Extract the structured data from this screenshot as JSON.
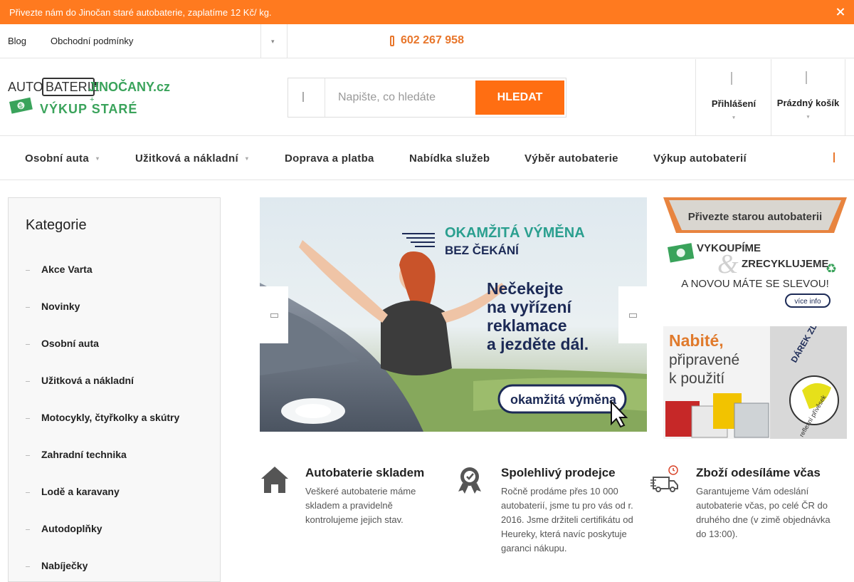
{
  "notice": {
    "text": "Přivezte nám do Jinočan staré autobaterie, zaplatíme 12 Kč/ kg."
  },
  "topbar": {
    "links": [
      "Blog",
      "Obchodní podmínky"
    ],
    "phone": "602 267 958"
  },
  "logo": {
    "line1_a": "AUTO",
    "line1_b": "BATERIE",
    "line1_c": "JINOČANY.cz",
    "line2": "VÝKUP STARÉ"
  },
  "search": {
    "placeholder": "Napište, co hledáte",
    "button": "HLEDAT"
  },
  "header": {
    "login": "Přihlášení",
    "cart": "Prázdný košík"
  },
  "nav": {
    "items": [
      "Osobní auta",
      "Užitková a nákladní",
      "Doprava a platba",
      "Nabídka služeb",
      "Výběr autobaterie",
      "Výkup autobaterií"
    ]
  },
  "sidebar": {
    "title": "Kategorie",
    "categories": [
      "Akce Varta",
      "Novinky",
      "Osobní auta",
      "Užitková a nákladní",
      "Motocykly, čtyřkolky a skútry",
      "Zahradní technika",
      "Lodě a karavany",
      "Autodoplňky",
      "Nabíječky"
    ]
  },
  "slider": {
    "headline1": "OKAMŽITÁ VÝMĚNA",
    "headline2": "BEZ ČEKÁNÍ",
    "text": [
      "Nečekejte",
      "na vyřízení",
      "reklamace",
      "a jezděte dál."
    ],
    "cta": "okamžitá výměna"
  },
  "banner1": {
    "title": "Přivezte starou autobaterii",
    "line1": "VYKOUPÍME",
    "amp": "&",
    "line2": "ZRECYKLUJEME",
    "line3": "A NOVOU MÁTE SE SLEVOU!",
    "more": "více info"
  },
  "banner2": {
    "line1": "Nabité,",
    "line2": "připravené",
    "line3": "k použití",
    "badge": "DÁREK ZDARMA",
    "badge_sub": "reflexní přívěsek"
  },
  "benefits": [
    {
      "icon": "house-icon",
      "title": "Autobaterie skladem",
      "text": "Veškeré autobaterie máme skladem a pravidelně kontrolujeme jejich stav."
    },
    {
      "icon": "certificate-icon",
      "title": "Spolehlivý prodejce",
      "text": "Ročně prodáme přes 10 000 autobaterií, jsme tu pro vás od r. 2016. Jsme držiteli certifikátu od Heureky, která navíc poskytuje garanci nákupu."
    },
    {
      "icon": "delivery-van-icon",
      "title": "Zboží odesíláme včas",
      "text": "Garantujeme Vám odeslání autobaterie včas, po celé ČR do druhého dne (v zimě objednávka do 13:00)."
    }
  ],
  "colors": {
    "accent": "#ff6e12",
    "notice": "#ff7a1f",
    "green": "#3aa35b",
    "teal": "#1f9aa0",
    "navy": "#1c2a56"
  }
}
